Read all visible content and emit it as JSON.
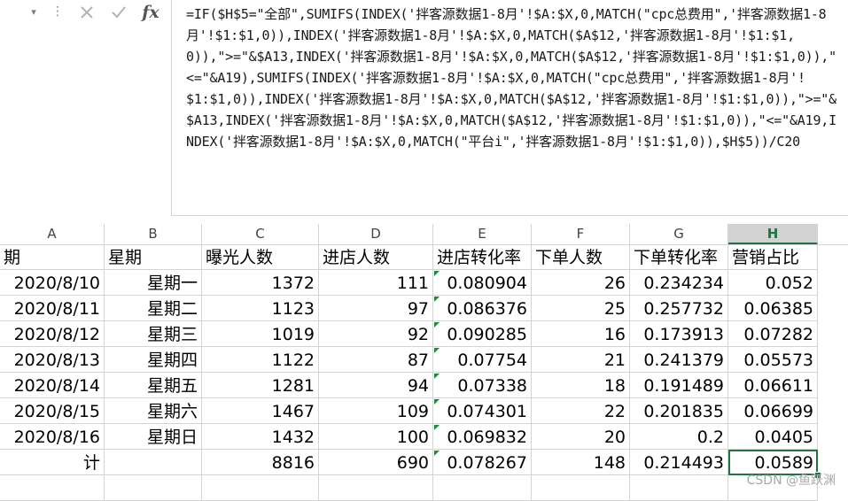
{
  "toolbar": {
    "namebox_dropdown": "▾",
    "separator": "⋮",
    "cancel_icon": "x-icon",
    "confirm_icon": "check-icon",
    "function_label": "fx"
  },
  "formula": "=IF($H$5=\"全部\",SUMIFS(INDEX('拌客源数据1-8月'!$A:$X,0,MATCH(\"cpc总费用\",'拌客源数据1-8月'!$1:$1,0)),INDEX('拌客源数据1-8月'!$A:$X,0,MATCH($A$12,'拌客源数据1-8月'!$1:$1,0)),\">=\"&$A13,INDEX('拌客源数据1-8月'!$A:$X,0,MATCH($A$12,'拌客源数据1-8月'!$1:$1,0)),\"<=\"&A19),SUMIFS(INDEX('拌客源数据1-8月'!$A:$X,0,MATCH(\"cpc总费用\",'拌客源数据1-8月'!$1:$1,0)),INDEX('拌客源数据1-8月'!$A:$X,0,MATCH($A$12,'拌客源数据1-8月'!$1:$1,0)),\">=\"&$A13,INDEX('拌客源数据1-8月'!$A:$X,0,MATCH($A$12,'拌客源数据1-8月'!$1:$1,0)),\"<=\"&A19,INDEX('拌客源数据1-8月'!$A:$X,0,MATCH(\"平台i\",'拌客源数据1-8月'!$1:$1,0)),$H$5))/C20",
  "columns": [
    "A",
    "B",
    "C",
    "D",
    "E",
    "F",
    "G",
    "H"
  ],
  "active_column": "H",
  "header_row": [
    "期",
    "星期",
    "曝光人数",
    "进店人数",
    "进店转化率",
    "下单人数",
    "下单转化率",
    "营销占比"
  ],
  "rows": [
    [
      "2020/8/10",
      "星期一",
      "1372",
      "111",
      "0.080904",
      "26",
      "0.234234",
      "0.052"
    ],
    [
      "2020/8/11",
      "星期二",
      "1123",
      "97",
      "0.086376",
      "25",
      "0.257732",
      "0.06385"
    ],
    [
      "2020/8/12",
      "星期三",
      "1019",
      "92",
      "0.090285",
      "16",
      "0.173913",
      "0.07282"
    ],
    [
      "2020/8/13",
      "星期四",
      "1122",
      "87",
      "0.07754",
      "21",
      "0.241379",
      "0.05573"
    ],
    [
      "2020/8/14",
      "星期五",
      "1281",
      "94",
      "0.07338",
      "18",
      "0.191489",
      "0.06611"
    ],
    [
      "2020/8/15",
      "星期六",
      "1467",
      "109",
      "0.074301",
      "22",
      "0.201835",
      "0.06699"
    ],
    [
      "2020/8/16",
      "星期日",
      "1432",
      "100",
      "0.069832",
      "20",
      "0.2",
      "0.0405"
    ]
  ],
  "total_row": [
    "计",
    "",
    "8816",
    "690",
    "0.078267",
    "148",
    "0.214493",
    "0.0589"
  ],
  "watermark": "CSDN @鱼跃渊",
  "colors": {
    "accent": "#217346",
    "error_triangle": "#1e8c3a"
  }
}
